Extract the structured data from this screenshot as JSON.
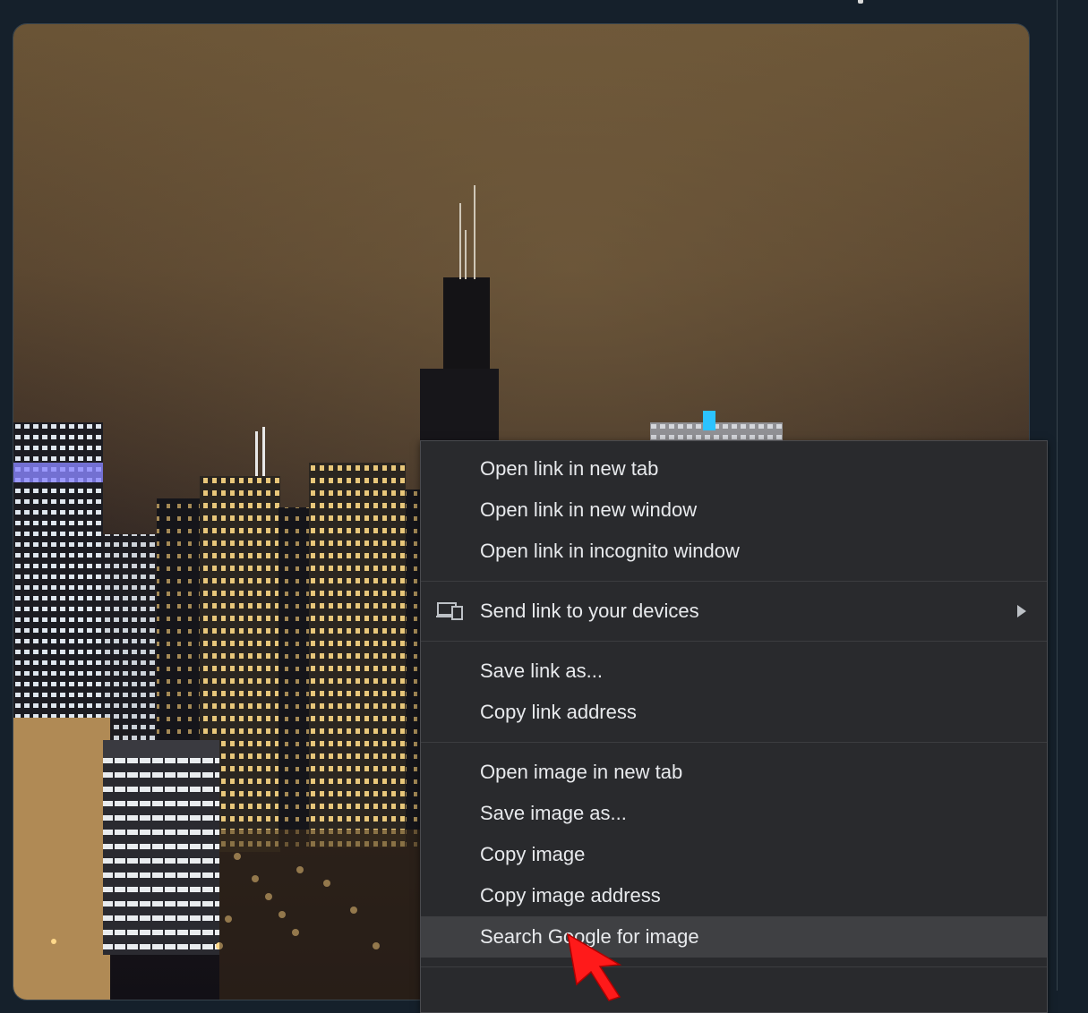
{
  "context_menu": {
    "groups": [
      {
        "items": [
          {
            "label": "Open link in new tab"
          },
          {
            "label": "Open link in new window"
          },
          {
            "label": "Open link in incognito window"
          }
        ]
      },
      {
        "items": [
          {
            "label": "Send link to your devices",
            "icon": "devices-icon",
            "submenu": true
          }
        ]
      },
      {
        "items": [
          {
            "label": "Save link as..."
          },
          {
            "label": "Copy link address"
          }
        ]
      },
      {
        "items": [
          {
            "label": "Open image in new tab"
          },
          {
            "label": "Save image as..."
          },
          {
            "label": "Copy image"
          },
          {
            "label": "Copy image address"
          },
          {
            "label": "Search Google for image",
            "highlighted": true
          }
        ]
      }
    ]
  },
  "colors": {
    "page_bg": "#15202b",
    "menu_bg": "#292a2d",
    "menu_text": "#e8eaed",
    "highlight": "#3f4043",
    "cursor": "#ff0000"
  },
  "icons": [
    "devices-icon",
    "submenu-arrow-icon",
    "cursor-arrow-icon"
  ]
}
